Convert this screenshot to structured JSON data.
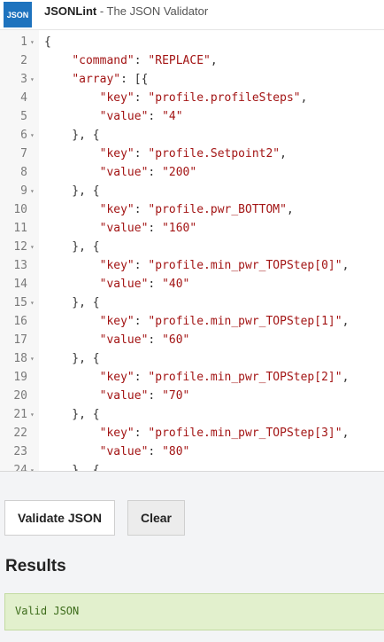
{
  "header": {
    "logo_text": "JSON",
    "app_name": "JSONLint",
    "tagline": " - The JSON Validator"
  },
  "editor": {
    "lines": [
      {
        "num": "1",
        "fold": true,
        "text": "{"
      },
      {
        "num": "2",
        "fold": false,
        "text": "    \"command\": \"REPLACE\","
      },
      {
        "num": "3",
        "fold": true,
        "text": "    \"array\": [{"
      },
      {
        "num": "4",
        "fold": false,
        "text": "        \"key\": \"profile.profileSteps\","
      },
      {
        "num": "5",
        "fold": false,
        "text": "        \"value\": \"4\""
      },
      {
        "num": "6",
        "fold": true,
        "text": "    }, {"
      },
      {
        "num": "7",
        "fold": false,
        "text": "        \"key\": \"profile.Setpoint2\","
      },
      {
        "num": "8",
        "fold": false,
        "text": "        \"value\": \"200\""
      },
      {
        "num": "9",
        "fold": true,
        "text": "    }, {"
      },
      {
        "num": "10",
        "fold": false,
        "text": "        \"key\": \"profile.pwr_BOTTOM\","
      },
      {
        "num": "11",
        "fold": false,
        "text": "        \"value\": \"160\""
      },
      {
        "num": "12",
        "fold": true,
        "text": "    }, {"
      },
      {
        "num": "13",
        "fold": false,
        "text": "        \"key\": \"profile.min_pwr_TOPStep[0]\","
      },
      {
        "num": "14",
        "fold": false,
        "text": "        \"value\": \"40\""
      },
      {
        "num": "15",
        "fold": true,
        "text": "    }, {"
      },
      {
        "num": "16",
        "fold": false,
        "text": "        \"key\": \"profile.min_pwr_TOPStep[1]\","
      },
      {
        "num": "17",
        "fold": false,
        "text": "        \"value\": \"60\""
      },
      {
        "num": "18",
        "fold": true,
        "text": "    }, {"
      },
      {
        "num": "19",
        "fold": false,
        "text": "        \"key\": \"profile.min_pwr_TOPStep[2]\","
      },
      {
        "num": "20",
        "fold": false,
        "text": "        \"value\": \"70\""
      },
      {
        "num": "21",
        "fold": true,
        "text": "    }, {"
      },
      {
        "num": "22",
        "fold": false,
        "text": "        \"key\": \"profile.min_pwr_TOPStep[3]\","
      },
      {
        "num": "23",
        "fold": false,
        "text": "        \"value\": \"80\""
      },
      {
        "num": "24",
        "fold": true,
        "text": "    }, {"
      }
    ]
  },
  "buttons": {
    "validate_label": "Validate JSON",
    "clear_label": "Clear"
  },
  "results": {
    "heading": "Results",
    "message": "Valid JSON"
  },
  "colors": {
    "logo_bg": "#1e73be",
    "string_color": "#a31515",
    "result_bg": "#e2f0cd",
    "result_text": "#3c6b1a"
  }
}
